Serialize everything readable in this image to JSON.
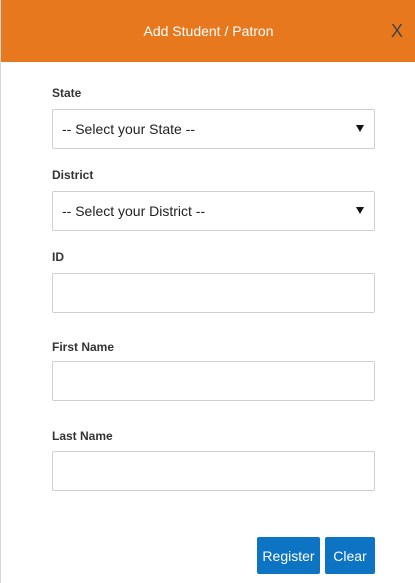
{
  "dialog": {
    "title": "Add Student / Patron",
    "close_label": "X",
    "header_color": "#e8781e"
  },
  "form": {
    "state": {
      "label": "State",
      "selected": "-- Select your State --"
    },
    "district": {
      "label": "District",
      "selected": "-- Select your District --"
    },
    "id": {
      "label": "ID",
      "value": ""
    },
    "first_name": {
      "label": "First Name",
      "value": ""
    },
    "last_name": {
      "label": "Last Name",
      "value": ""
    }
  },
  "actions": {
    "register_label": "Register",
    "clear_label": "Clear",
    "button_color": "#0d74c3"
  }
}
